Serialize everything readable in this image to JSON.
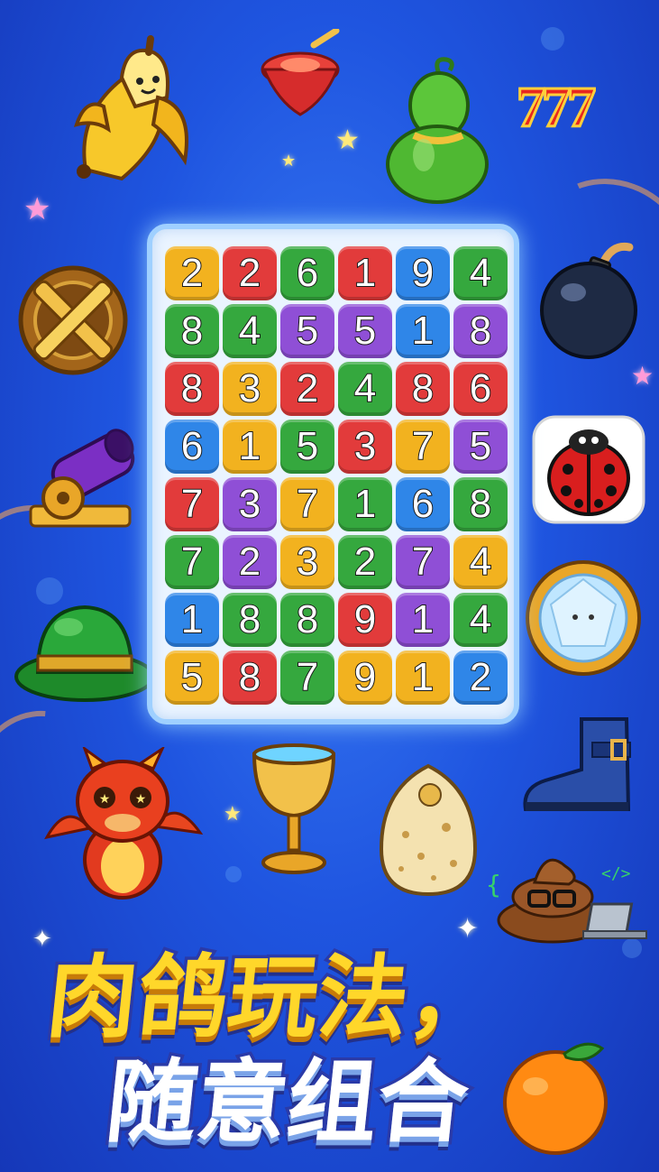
{
  "board": {
    "colors": {
      "yellow": "#f2b21f",
      "red": "#e23b3b",
      "green": "#35a83e",
      "purple": "#8f4fd6",
      "blue": "#2f86e8"
    },
    "rows": [
      [
        {
          "n": "2",
          "c": "yellow"
        },
        {
          "n": "2",
          "c": "red"
        },
        {
          "n": "6",
          "c": "green"
        },
        {
          "n": "1",
          "c": "red"
        },
        {
          "n": "9",
          "c": "blue"
        },
        {
          "n": "4",
          "c": "green"
        }
      ],
      [
        {
          "n": "8",
          "c": "green"
        },
        {
          "n": "4",
          "c": "green"
        },
        {
          "n": "5",
          "c": "purple"
        },
        {
          "n": "5",
          "c": "purple"
        },
        {
          "n": "1",
          "c": "blue"
        },
        {
          "n": "8",
          "c": "purple"
        }
      ],
      [
        {
          "n": "8",
          "c": "red"
        },
        {
          "n": "3",
          "c": "yellow"
        },
        {
          "n": "2",
          "c": "red"
        },
        {
          "n": "4",
          "c": "green"
        },
        {
          "n": "8",
          "c": "red"
        },
        {
          "n": "6",
          "c": "red"
        }
      ],
      [
        {
          "n": "6",
          "c": "blue"
        },
        {
          "n": "1",
          "c": "yellow"
        },
        {
          "n": "5",
          "c": "green"
        },
        {
          "n": "3",
          "c": "red"
        },
        {
          "n": "7",
          "c": "yellow"
        },
        {
          "n": "5",
          "c": "purple"
        }
      ],
      [
        {
          "n": "7",
          "c": "red"
        },
        {
          "n": "3",
          "c": "purple"
        },
        {
          "n": "7",
          "c": "yellow"
        },
        {
          "n": "1",
          "c": "green"
        },
        {
          "n": "6",
          "c": "blue"
        },
        {
          "n": "8",
          "c": "green"
        }
      ],
      [
        {
          "n": "7",
          "c": "green"
        },
        {
          "n": "2",
          "c": "purple"
        },
        {
          "n": "3",
          "c": "yellow"
        },
        {
          "n": "2",
          "c": "green"
        },
        {
          "n": "7",
          "c": "purple"
        },
        {
          "n": "4",
          "c": "yellow"
        }
      ],
      [
        {
          "n": "1",
          "c": "blue"
        },
        {
          "n": "8",
          "c": "green"
        },
        {
          "n": "8",
          "c": "green"
        },
        {
          "n": "9",
          "c": "red"
        },
        {
          "n": "1",
          "c": "purple"
        },
        {
          "n": "4",
          "c": "green"
        }
      ],
      [
        {
          "n": "5",
          "c": "yellow"
        },
        {
          "n": "8",
          "c": "red"
        },
        {
          "n": "7",
          "c": "green"
        },
        {
          "n": "9",
          "c": "yellow"
        },
        {
          "n": "1",
          "c": "yellow"
        },
        {
          "n": "2",
          "c": "blue"
        }
      ]
    ]
  },
  "slot_text": "777",
  "headline": {
    "line1": "肉鸽玩法，",
    "line2": "随意组合"
  },
  "icons": [
    "banana-icon",
    "spinning-top-icon",
    "gourd-icon",
    "777-icon",
    "crossed-swords-shield-icon",
    "bomb-icon",
    "cannon-icon",
    "ladybug-icon",
    "green-hat-icon",
    "diamond-medallion-icon",
    "dragon-icon",
    "golden-chalice-icon",
    "spotted-egg-icon",
    "boot-icon",
    "poop-laptop-icon",
    "orange-icon"
  ]
}
